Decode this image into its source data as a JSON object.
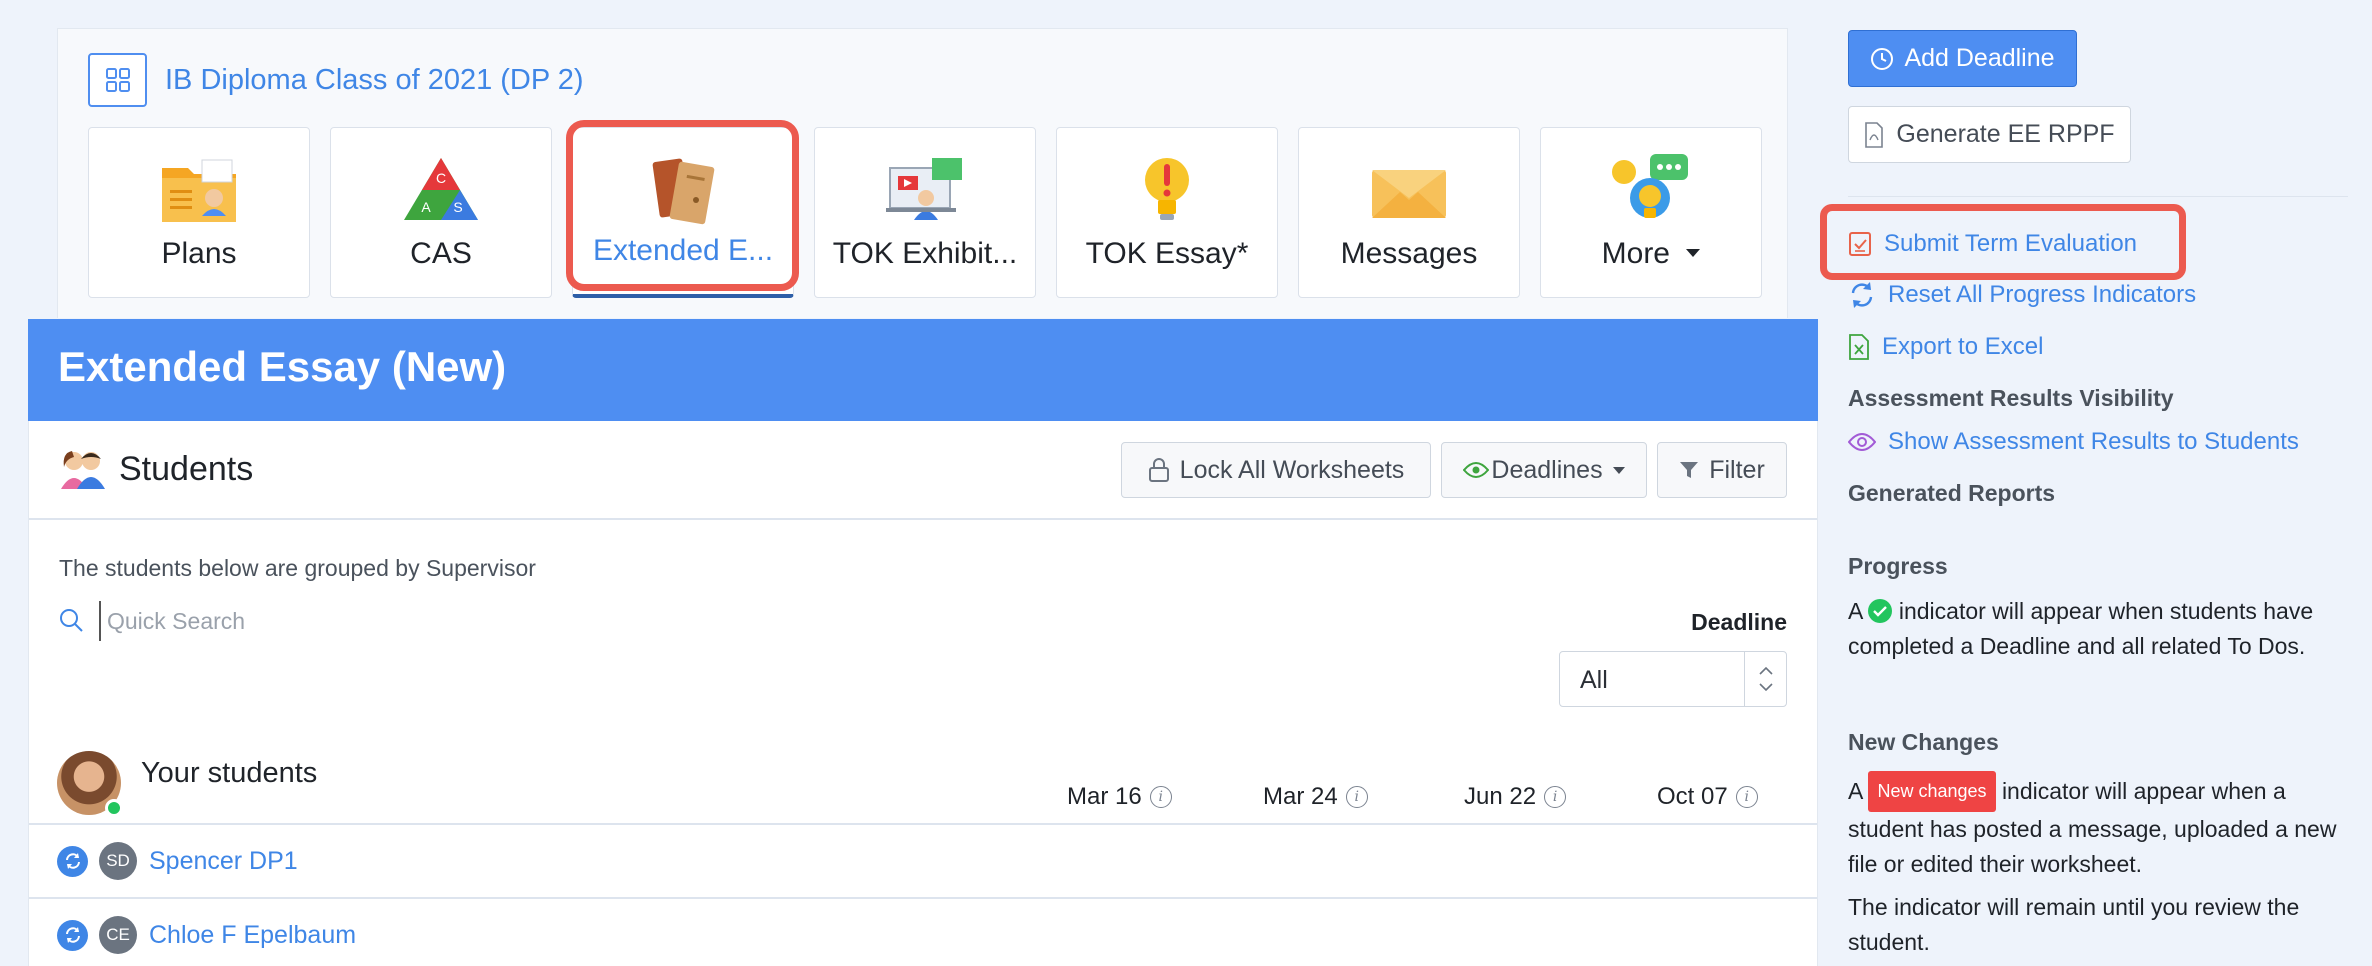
{
  "program": {
    "title": "IB Diploma Class of 2021 (DP 2)"
  },
  "tiles": [
    {
      "label": "Plans",
      "icon": "plans-folder-icon"
    },
    {
      "label": "CAS",
      "icon": "cas-triangle-icon"
    },
    {
      "label": "Extended E...",
      "icon": "extended-essay-books-icon",
      "active": true
    },
    {
      "label": "TOK Exhibit...",
      "icon": "tok-exhibition-icon"
    },
    {
      "label": "TOK Essay*",
      "icon": "tok-essay-bulb-icon"
    },
    {
      "label": "Messages",
      "icon": "messages-envelope-icon"
    },
    {
      "label": "More",
      "icon": "more-bulb-chat-icon"
    }
  ],
  "cas_letters": {
    "c": "C",
    "a": "A",
    "s": "S"
  },
  "banner": {
    "title": "Extended Essay (New)"
  },
  "students": {
    "title": "Students",
    "lock_all": "Lock All Worksheets",
    "deadlines": "Deadlines",
    "filter": "Filter",
    "grouped_note": "The students below are grouped by Supervisor",
    "search_placeholder": "Quick Search",
    "deadline_label": "Deadline",
    "deadline_value": "All",
    "group_label": "Your students",
    "dates": [
      "Mar 16",
      "Mar 24",
      "Jun 22",
      "Oct 07"
    ],
    "info_glyph": "i",
    "rows": [
      {
        "initials": "SD",
        "name": "Spencer DP1"
      },
      {
        "initials": "CE",
        "name": "Chloe F Epelbaum"
      }
    ]
  },
  "sidebar": {
    "add_deadline": "Add Deadline",
    "generate": "Generate EE RPPF",
    "submit_eval": "Submit Term Evaluation",
    "reset": "Reset All Progress Indicators",
    "export": "Export to Excel",
    "visibility_heading": "Assessment Results Visibility",
    "show_results": "Show Assessment Results to Students",
    "generated_reports": "Generated Reports",
    "progress_heading": "Progress",
    "progress_pre": "A",
    "progress_text": "indicator will appear when students have completed a Deadline and all related To Dos.",
    "new_changes_heading": "New Changes",
    "new_changes_pre": "A",
    "new_changes_badge": "New changes",
    "new_changes_text": "indicator will appear when a student has posted a message, uploaded a new file or edited their worksheet.",
    "remain_text": "The indicator will remain until you review the student."
  },
  "colors": {
    "accent": "#4e8ef2",
    "link": "#3f86e6",
    "highlight": "#ec5a4f",
    "success": "#22c55e",
    "danger": "#ef4444"
  }
}
